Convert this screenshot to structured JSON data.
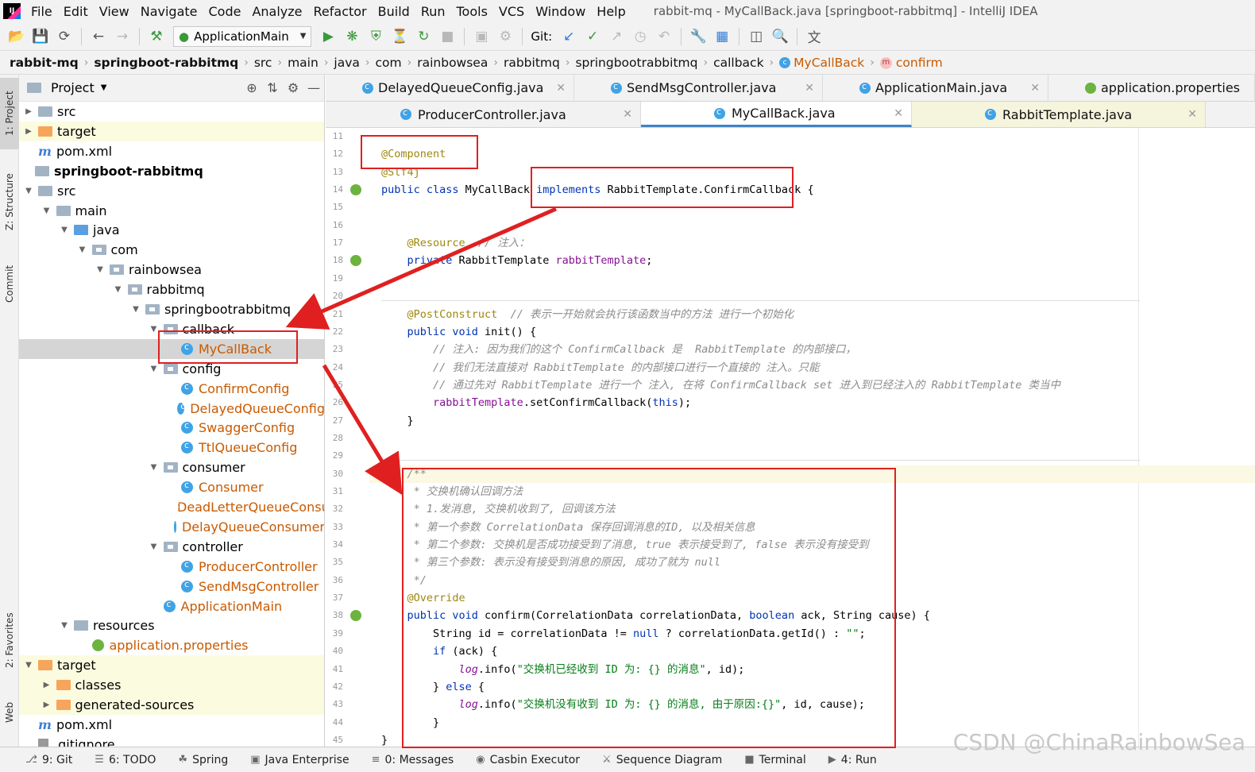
{
  "menubar": {
    "items": [
      "File",
      "Edit",
      "View",
      "Navigate",
      "Code",
      "Analyze",
      "Refactor",
      "Build",
      "Run",
      "Tools",
      "VCS",
      "Window",
      "Help"
    ],
    "title": "rabbit-mq - MyCallBack.java [springboot-rabbitmq] - IntelliJ IDEA"
  },
  "toolbar": {
    "run_config": "ApplicationMain",
    "git_label": "Git:"
  },
  "breadcrumb": {
    "items": [
      "rabbit-mq",
      "springboot-rabbitmq",
      "src",
      "main",
      "java",
      "com",
      "rainbowsea",
      "rabbitmq",
      "springbootrabbitmq",
      "callback",
      "MyCallBack",
      "confirm"
    ]
  },
  "toolstrip": {
    "tabs": [
      "1: Project",
      "Z: Structure",
      "Commit",
      "2: Favorites",
      "Web"
    ]
  },
  "project_panel": {
    "title": "Project",
    "tree": [
      {
        "label": "src",
        "icon": "folder",
        "indent": 0,
        "arrow": "right"
      },
      {
        "label": "target",
        "icon": "folder-orange",
        "indent": 0,
        "arrow": "right",
        "excluded": true
      },
      {
        "label": "pom.xml",
        "icon": "maven",
        "indent": 0,
        "arrow": ""
      },
      {
        "label": "springboot-rabbitmq",
        "icon": "module",
        "indent": -1,
        "arrow": "",
        "bold": true
      },
      {
        "label": "src",
        "icon": "folder",
        "indent": 0,
        "arrow": "down"
      },
      {
        "label": "main",
        "icon": "folder",
        "indent": 1,
        "arrow": "down"
      },
      {
        "label": "java",
        "icon": "folder-blue",
        "indent": 2,
        "arrow": "down"
      },
      {
        "label": "com",
        "icon": "package",
        "indent": 3,
        "arrow": "down"
      },
      {
        "label": "rainbowsea",
        "icon": "package",
        "indent": 4,
        "arrow": "down"
      },
      {
        "label": "rabbitmq",
        "icon": "package",
        "indent": 5,
        "arrow": "down"
      },
      {
        "label": "springbootrabbitmq",
        "icon": "package",
        "indent": 6,
        "arrow": "down"
      },
      {
        "label": "callback",
        "icon": "package",
        "indent": 7,
        "arrow": "down"
      },
      {
        "label": "MyCallBack",
        "icon": "class",
        "indent": 8,
        "arrow": "",
        "orange": true,
        "selected": true
      },
      {
        "label": "config",
        "icon": "package",
        "indent": 7,
        "arrow": "down"
      },
      {
        "label": "ConfirmConfig",
        "icon": "class",
        "indent": 8,
        "arrow": "",
        "orange": true
      },
      {
        "label": "DelayedQueueConfig",
        "icon": "class",
        "indent": 8,
        "arrow": "",
        "orange": true
      },
      {
        "label": "SwaggerConfig",
        "icon": "class",
        "indent": 8,
        "arrow": "",
        "orange": true
      },
      {
        "label": "TtlQueueConfig",
        "icon": "class",
        "indent": 8,
        "arrow": "",
        "orange": true
      },
      {
        "label": "consumer",
        "icon": "package",
        "indent": 7,
        "arrow": "down"
      },
      {
        "label": "Consumer",
        "icon": "class",
        "indent": 8,
        "arrow": "",
        "orange": true
      },
      {
        "label": "DeadLetterQueueConsumer",
        "icon": "class",
        "indent": 8,
        "arrow": "",
        "orange": true
      },
      {
        "label": "DelayQueueConsumer",
        "icon": "class",
        "indent": 8,
        "arrow": "",
        "orange": true
      },
      {
        "label": "controller",
        "icon": "package",
        "indent": 7,
        "arrow": "down"
      },
      {
        "label": "ProducerController",
        "icon": "class",
        "indent": 8,
        "arrow": "",
        "orange": true
      },
      {
        "label": "SendMsgController",
        "icon": "class",
        "indent": 8,
        "arrow": "",
        "orange": true
      },
      {
        "label": "ApplicationMain",
        "icon": "spring-class",
        "indent": 7,
        "arrow": "",
        "orange": true
      },
      {
        "label": "resources",
        "icon": "folder-res",
        "indent": 2,
        "arrow": "down"
      },
      {
        "label": "application.properties",
        "icon": "spring",
        "indent": 3,
        "arrow": "",
        "orange": true
      },
      {
        "label": "target",
        "icon": "folder-orange",
        "indent": 0,
        "arrow": "down",
        "excluded": true
      },
      {
        "label": "classes",
        "icon": "folder-orange",
        "indent": 1,
        "arrow": "right",
        "excluded": true
      },
      {
        "label": "generated-sources",
        "icon": "folder-orange",
        "indent": 1,
        "arrow": "right",
        "excluded": true
      },
      {
        "label": "pom.xml",
        "icon": "maven",
        "indent": 0,
        "arrow": ""
      },
      {
        "label": ".gitignore",
        "icon": "git",
        "indent": 0,
        "arrow": ""
      }
    ]
  },
  "editor_tabs": {
    "row1": [
      {
        "label": "DelayedQueueConfig.java",
        "icon": "class"
      },
      {
        "label": "SendMsgController.java",
        "icon": "class"
      },
      {
        "label": "ApplicationMain.java",
        "icon": "spring-class"
      },
      {
        "label": "application.properties",
        "icon": "spring"
      }
    ],
    "row2": [
      {
        "label": "ProducerController.java",
        "icon": "class"
      },
      {
        "label": "MyCallBack.java",
        "icon": "class",
        "active": true
      },
      {
        "label": "RabbitTemplate.java",
        "icon": "class",
        "readonly": true
      }
    ]
  },
  "code": {
    "line_numbers": [
      "11",
      "12",
      "13",
      "14",
      "15",
      "16",
      "17",
      "18",
      "19",
      "20",
      "21",
      "22",
      "23",
      "24",
      "25",
      "26",
      "27",
      "28",
      "29",
      "30",
      "31",
      "32",
      "33",
      "34",
      "35",
      "36",
      "37",
      "38",
      "39",
      "40",
      "41",
      "42",
      "43",
      "44",
      "45"
    ],
    "lines": [
      [],
      [
        {
          "t": "@Component",
          "c": "an"
        }
      ],
      [
        {
          "t": "@Slf4j",
          "c": "an"
        }
      ],
      [
        {
          "t": "public class ",
          "c": "kw"
        },
        {
          "t": "MyCallBack ",
          "c": "cl"
        },
        {
          "t": "implements ",
          "c": "kw"
        },
        {
          "t": "RabbitTemplate.ConfirmCallback ",
          "c": "cl"
        },
        {
          "t": "{",
          "c": "cl"
        }
      ],
      [],
      [],
      [
        {
          "t": "    @Resource  ",
          "c": "an"
        },
        {
          "t": "// 注入：",
          "c": "cm"
        }
      ],
      [
        {
          "t": "    private ",
          "c": "kw"
        },
        {
          "t": "RabbitTemplate ",
          "c": "cl"
        },
        {
          "t": "rabbitTemplate",
          "c": "fld"
        },
        {
          "t": ";",
          "c": "cl"
        }
      ],
      [],
      [],
      [
        {
          "t": "    @PostConstruct  ",
          "c": "an"
        },
        {
          "t": "// 表示一开始就会执行该函数当中的方法 进行一个初始化",
          "c": "cm"
        }
      ],
      [
        {
          "t": "    public void ",
          "c": "kw"
        },
        {
          "t": "init() {",
          "c": "cl"
        }
      ],
      [
        {
          "t": "        // 注入: 因为我们的这个 ConfirmCallback 是  RabbitTemplate 的内部接口，",
          "c": "cm"
        }
      ],
      [
        {
          "t": "        // 我们无法直接对 RabbitTemplate 的内部接口进行一个直接的 注入。只能",
          "c": "cm"
        }
      ],
      [
        {
          "t": "        // 通过先对 RabbitTemplate 进行一个 注入, 在将 ConfirmCallback set 进入到已经注入的 RabbitTemplate 类当中",
          "c": "cm"
        }
      ],
      [
        {
          "t": "        rabbitTemplate",
          "c": "fld"
        },
        {
          "t": ".setConfirmCallback(",
          "c": "cl"
        },
        {
          "t": "this",
          "c": "kw"
        },
        {
          "t": ");",
          "c": "cl"
        }
      ],
      [
        {
          "t": "    }",
          "c": "cl"
        }
      ],
      [],
      [],
      [
        {
          "t": "    /**",
          "c": "cm"
        }
      ],
      [
        {
          "t": "     * 交换机确认回调方法",
          "c": "cm"
        }
      ],
      [
        {
          "t": "     * 1.发消息, 交换机收到了, 回调该方法",
          "c": "cm"
        }
      ],
      [
        {
          "t": "     * 第一个参数 CorrelationData 保存回调消息的ID, 以及相关信息",
          "c": "cm"
        }
      ],
      [
        {
          "t": "     * 第二个参数: 交换机是否成功接受到了消息, true 表示接受到了, false 表示没有接受到",
          "c": "cm"
        }
      ],
      [
        {
          "t": "     * 第三个参数: 表示没有接受到消息的原因, 成功了就为 null",
          "c": "cm"
        }
      ],
      [
        {
          "t": "     */",
          "c": "cm"
        }
      ],
      [
        {
          "t": "    @Override",
          "c": "an"
        }
      ],
      [
        {
          "t": "    public void ",
          "c": "kw"
        },
        {
          "t": "confirm(CorrelationData correlationData, ",
          "c": "cl"
        },
        {
          "t": "boolean ",
          "c": "kw"
        },
        {
          "t": "ack, String cause) {",
          "c": "cl"
        }
      ],
      [
        {
          "t": "        String id = correlationData != ",
          "c": "cl"
        },
        {
          "t": "null",
          "c": "kw"
        },
        {
          "t": " ? correlationData.getId() : ",
          "c": "cl"
        },
        {
          "t": "\"\"",
          "c": "str"
        },
        {
          "t": ";",
          "c": "cl"
        }
      ],
      [
        {
          "t": "        if ",
          "c": "kw"
        },
        {
          "t": "(ack) {",
          "c": "cl"
        }
      ],
      [
        {
          "t": "            log",
          "c": "lg"
        },
        {
          "t": ".info(",
          "c": "cl"
        },
        {
          "t": "\"交换机已经收到 ID 为: {} 的消息\"",
          "c": "str"
        },
        {
          "t": ", id);",
          "c": "cl"
        }
      ],
      [
        {
          "t": "        } ",
          "c": "cl"
        },
        {
          "t": "else ",
          "c": "kw"
        },
        {
          "t": "{",
          "c": "cl"
        }
      ],
      [
        {
          "t": "            log",
          "c": "lg"
        },
        {
          "t": ".info(",
          "c": "cl"
        },
        {
          "t": "\"交换机没有收到 ID 为: {} 的消息, 由于原因:{}\"",
          "c": "str"
        },
        {
          "t": ", id, cause);",
          "c": "cl"
        }
      ],
      [
        {
          "t": "        }",
          "c": "cl"
        }
      ],
      [
        {
          "t": "}",
          "c": "cl"
        }
      ]
    ]
  },
  "statusbar": {
    "items": [
      {
        "label": "9: Git",
        "icon": "git-icon"
      },
      {
        "label": "6: TODO",
        "icon": "todo-icon"
      },
      {
        "label": "Spring",
        "icon": "spring-icon"
      },
      {
        "label": "Java Enterprise",
        "icon": "java-enterprise-icon"
      },
      {
        "label": "0: Messages",
        "icon": "messages-icon"
      },
      {
        "label": "Casbin Executor",
        "icon": "casbin-icon"
      },
      {
        "label": "Sequence Diagram",
        "icon": "sequence-icon"
      },
      {
        "label": "Terminal",
        "icon": "terminal-icon"
      },
      {
        "label": "4: Run",
        "icon": "run-icon"
      }
    ]
  },
  "watermark": "CSDN @ChinaRainbowSea"
}
